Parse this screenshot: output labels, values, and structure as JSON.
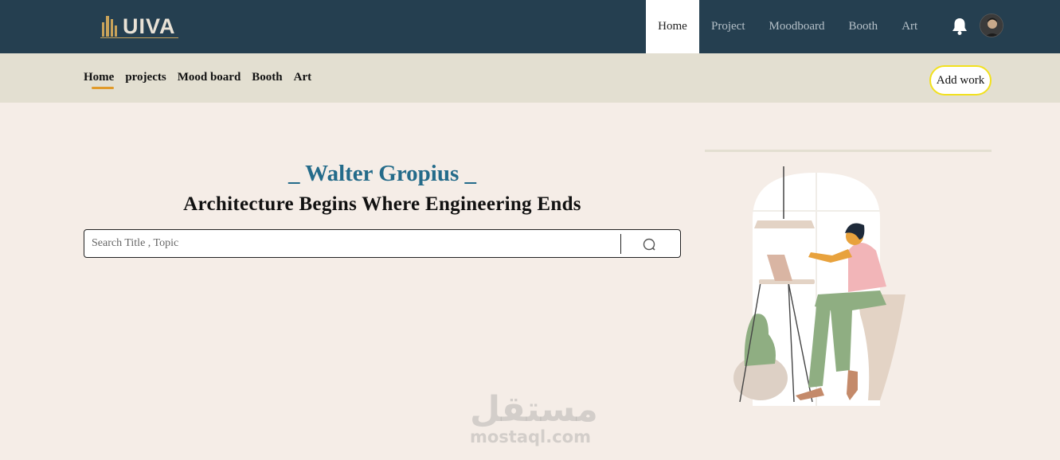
{
  "header": {
    "logo_text": "UIVA",
    "nav": [
      {
        "label": "Home",
        "active": true
      },
      {
        "label": "Project",
        "active": false
      },
      {
        "label": "Moodboard",
        "active": false
      },
      {
        "label": "Booth",
        "active": false
      },
      {
        "label": "Art",
        "active": false
      }
    ],
    "notification_icon": "bell-icon",
    "avatar": "user-avatar"
  },
  "subnav": {
    "items": [
      {
        "label": "Home",
        "active": true
      },
      {
        "label": "projects",
        "active": false
      },
      {
        "label": "Mood board",
        "active": false
      },
      {
        "label": "Booth",
        "active": false
      },
      {
        "label": "Art",
        "active": false
      }
    ],
    "add_work_label": "Add work"
  },
  "hero": {
    "author": "_ Walter Gropius _",
    "quote": "Architecture Begins Where Engineering Ends",
    "search_placeholder": "Search Title , Topic",
    "search_icon": "search-icon"
  },
  "watermark": {
    "arabic": "مستقل",
    "latin": "mostaql.com"
  },
  "colors": {
    "topbar": "#253f50",
    "subbar": "#e3dfd1",
    "background": "#f5ede7",
    "accent_author": "#246b8a",
    "active_underline": "#e19a2a",
    "add_work_border": "#f2e11d"
  }
}
